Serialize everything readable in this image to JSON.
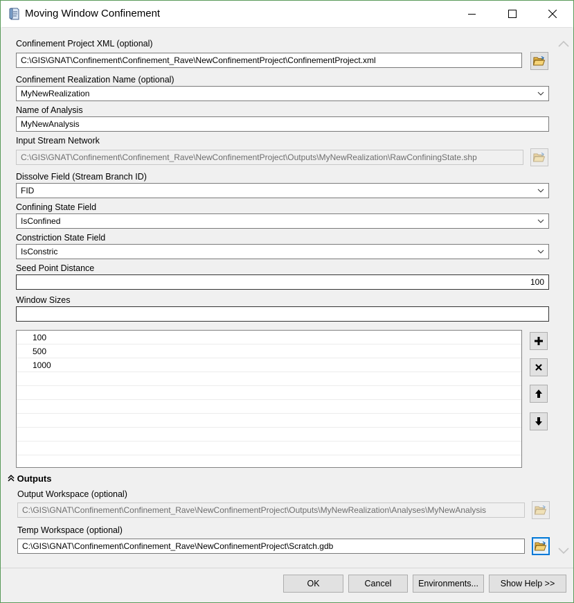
{
  "window": {
    "title": "Moving Window Confinement"
  },
  "fields": {
    "project_xml": {
      "label": "Confinement Project XML (optional)",
      "value": "C:\\GIS\\GNAT\\Confinement\\Confinement_Rave\\NewConfinementProject\\ConfinementProject.xml"
    },
    "realization": {
      "label": "Confinement Realization Name (optional)",
      "value": "MyNewRealization"
    },
    "analysis_name": {
      "label": "Name of Analysis",
      "value": "MyNewAnalysis"
    },
    "stream_network": {
      "label": "Input Stream Network",
      "value": "C:\\GIS\\GNAT\\Confinement\\Confinement_Rave\\NewConfinementProject\\Outputs\\MyNewRealization\\RawConfiningState.shp"
    },
    "dissolve_field": {
      "label": "Dissolve Field (Stream Branch ID)",
      "value": "FID"
    },
    "confining_state": {
      "label": "Confining State Field",
      "value": "IsConfined"
    },
    "constriction_state": {
      "label": "Constriction State Field",
      "value": "IsConstric"
    },
    "seed_distance": {
      "label": "Seed Point Distance",
      "value": "100"
    },
    "window_sizes": {
      "label": "Window Sizes",
      "value": "",
      "items": [
        "100",
        "500",
        "1000"
      ]
    }
  },
  "outputs": {
    "heading": "Outputs",
    "output_workspace": {
      "label": "Output Workspace (optional)",
      "value": "C:\\GIS\\GNAT\\Confinement\\Confinement_Rave\\NewConfinementProject\\Outputs\\MyNewRealization\\Analyses\\MyNewAnalysis"
    },
    "temp_workspace": {
      "label": "Temp Workspace (optional)",
      "value": "C:\\GIS\\GNAT\\Confinement\\Confinement_Rave\\NewConfinementProject\\Scratch.gdb"
    }
  },
  "buttons": {
    "ok": "OK",
    "cancel": "Cancel",
    "environments": "Environments...",
    "help": "Show Help >>"
  },
  "icons": {
    "app": "script-tool-icon",
    "browse": "folder-open-icon",
    "add": "plus-icon",
    "remove": "x-icon",
    "up": "arrow-up-icon",
    "down": "arrow-down-icon"
  }
}
